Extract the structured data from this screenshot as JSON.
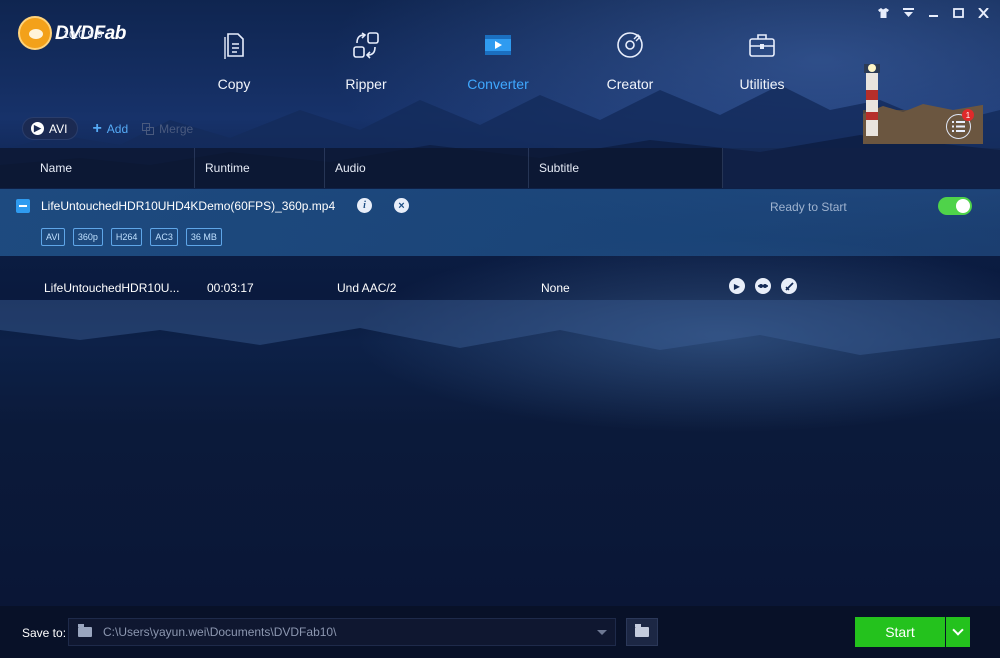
{
  "app": {
    "name": "DVDFab",
    "version": "10.0.9.9"
  },
  "window_controls": [
    "shirt-icon",
    "dropdown-icon",
    "minimize-icon",
    "maximize-icon",
    "close-icon"
  ],
  "nav": {
    "items": [
      {
        "label": "Copy",
        "icon": "copy-icon",
        "active": false
      },
      {
        "label": "Ripper",
        "icon": "ripper-icon",
        "active": false
      },
      {
        "label": "Converter",
        "icon": "converter-icon",
        "active": true
      },
      {
        "label": "Creator",
        "icon": "creator-icon",
        "active": false
      },
      {
        "label": "Utilities",
        "icon": "utilities-icon",
        "active": false
      }
    ],
    "active_color": "#3fa8ff"
  },
  "toolbar": {
    "profile_label": "AVI",
    "add_label": "Add",
    "merge_label": "Merge",
    "task_count": "1"
  },
  "columns": {
    "name": "Name",
    "runtime": "Runtime",
    "audio": "Audio",
    "subtitle": "Subtitle"
  },
  "file": {
    "name": "LifeUntouchedHDR10UHD4KDemo(60FPS)_360p.mp4",
    "info_glyph": "i",
    "remove_glyph": "×",
    "tags": [
      "AVI",
      "360p",
      "H264",
      "AC3",
      "36 MB"
    ],
    "status": "Ready to Start",
    "enabled": true
  },
  "title_row": {
    "name": "LifeUntouchedHDR10U...",
    "runtime": "00:03:17",
    "audio": "Und  AAC/2",
    "subtitle": "None"
  },
  "bottom": {
    "save_label": "Save to:",
    "path": "C:\\Users\\yayun.wei\\Documents\\DVDFab10\\",
    "start_label": "Start",
    "start_color": "#24c21d"
  }
}
